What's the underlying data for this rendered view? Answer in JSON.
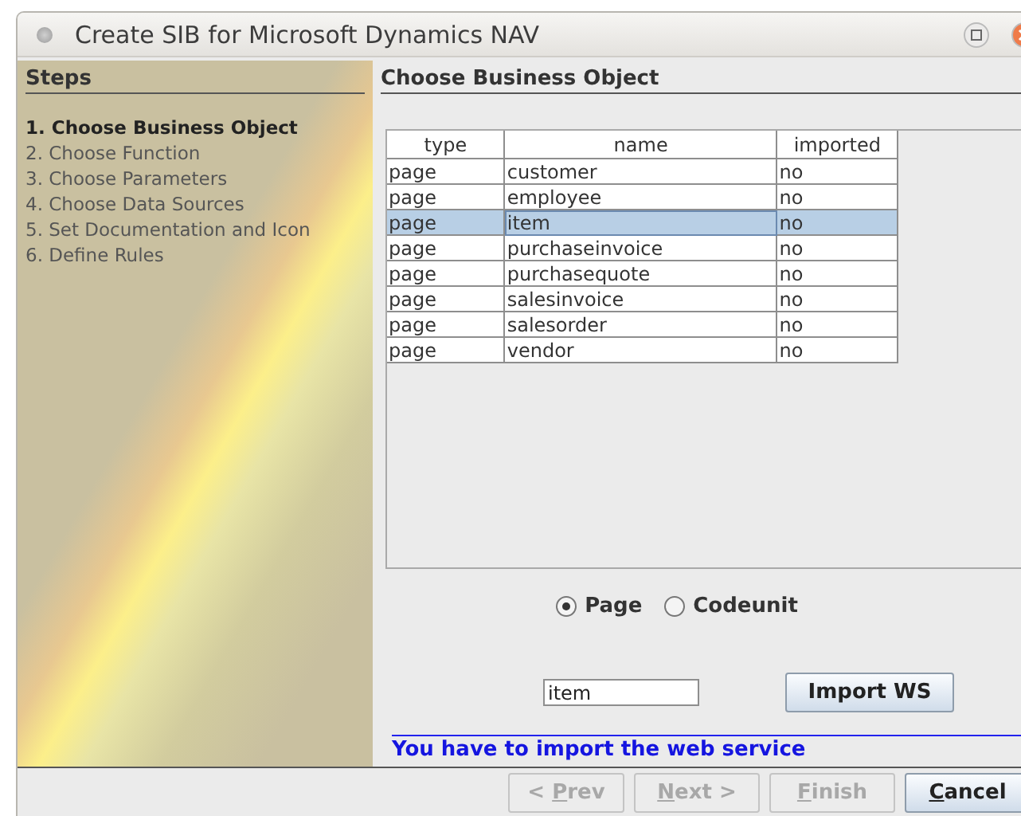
{
  "window": {
    "title": "Create SIB for Microsoft Dynamics NAV"
  },
  "steps": {
    "title": "Steps",
    "items": [
      {
        "label": "1. Choose Business Object",
        "selected": true
      },
      {
        "label": "2. Choose Function",
        "selected": false
      },
      {
        "label": "3. Choose Parameters",
        "selected": false
      },
      {
        "label": "4. Choose Data Sources",
        "selected": false
      },
      {
        "label": "5. Set Documentation and Icon",
        "selected": false
      },
      {
        "label": "6. Define Rules",
        "selected": false
      }
    ]
  },
  "content": {
    "title": "Choose Business Object"
  },
  "table": {
    "columns": [
      "type",
      "name",
      "imported"
    ],
    "rows": [
      {
        "cells": [
          "page",
          "customer",
          "no"
        ],
        "selected": false
      },
      {
        "cells": [
          "page",
          "employee",
          "no"
        ],
        "selected": false
      },
      {
        "cells": [
          "page",
          "item",
          "no"
        ],
        "selected": true
      },
      {
        "cells": [
          "page",
          "purchaseinvoice",
          "no"
        ],
        "selected": false
      },
      {
        "cells": [
          "page",
          "purchasequote",
          "no"
        ],
        "selected": false
      },
      {
        "cells": [
          "page",
          "salesinvoice",
          "no"
        ],
        "selected": false
      },
      {
        "cells": [
          "page",
          "salesorder",
          "no"
        ],
        "selected": false
      },
      {
        "cells": [
          "page",
          "vendor",
          "no"
        ],
        "selected": false
      }
    ]
  },
  "object_type": [
    {
      "label": "Page",
      "selected": true
    },
    {
      "label": "Codeunit",
      "selected": false
    }
  ],
  "name_field": {
    "value": "item"
  },
  "import_button": {
    "label": "Import WS"
  },
  "message": "You have to import the web service",
  "buttons": [
    {
      "before": "< ",
      "mnemonic": "P",
      "after": "rev",
      "disabled": true
    },
    {
      "mnemonic": "N",
      "after": "ext >",
      "disabled": true
    },
    {
      "mnemonic": "F",
      "after": "inish",
      "disabled": true
    },
    {
      "mnemonic": "C",
      "after": "ancel",
      "disabled": false
    }
  ]
}
